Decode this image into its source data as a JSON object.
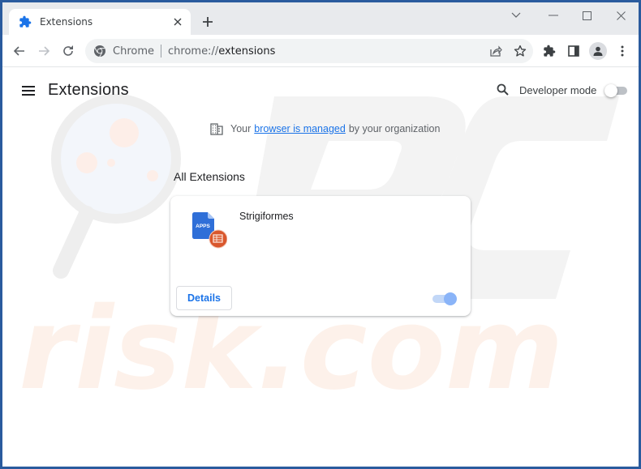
{
  "browser": {
    "tab": {
      "title": "Extensions",
      "icon": "puzzle-icon",
      "close_glyph": "✕"
    },
    "new_tab_glyph": "+",
    "window_controls": [
      "tab-search",
      "minimize",
      "maximize",
      "close"
    ],
    "omnibox": {
      "site_label": "Chrome",
      "url_scheme": "chrome://",
      "url_path": "extensions"
    },
    "toolbar_icons": [
      "share-icon",
      "bookmark-star-icon",
      "extensions-puzzle-icon",
      "side-panel-icon",
      "profile-avatar-icon",
      "more-menu-icon"
    ]
  },
  "page": {
    "title": "Extensions",
    "developer_mode": {
      "label": "Developer mode",
      "enabled": false
    },
    "managed_notice": {
      "prefix": "Your",
      "link": "browser is managed",
      "suffix": "by your organization"
    },
    "section_title": "All Extensions",
    "extensions": [
      {
        "name": "Strigiformes",
        "icon_text": "APPS",
        "details_label": "Details",
        "enabled": true
      }
    ]
  },
  "colors": {
    "accent": "#1a73e8",
    "toggle_on": "#8ab4f8",
    "app_icon_blue": "#2f6fd8",
    "app_badge_orange": "#d9572d",
    "window_border": "#2a5b9e"
  }
}
